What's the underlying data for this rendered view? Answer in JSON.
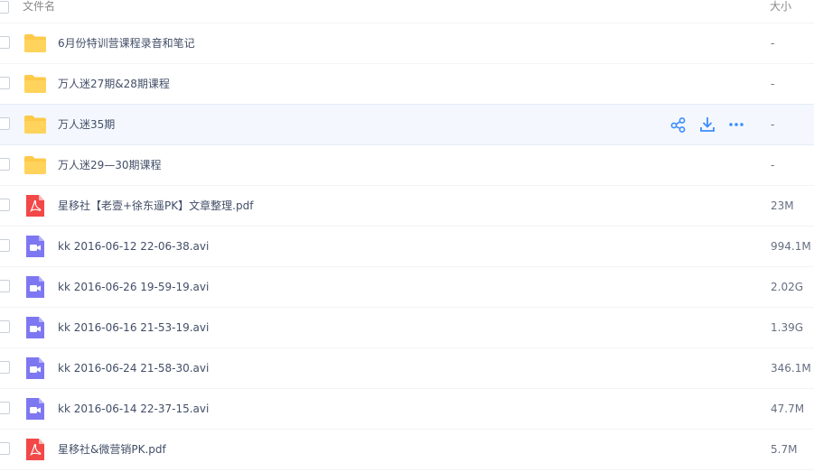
{
  "header": {
    "name_label": "文件名",
    "size_label": "大小"
  },
  "colors": {
    "folder": "#ffc94a",
    "pdf": "#f24848",
    "video": "#7d78f2",
    "action": "#3b8cff"
  },
  "rows": [
    {
      "name": "6月份特训营课程录音和笔记",
      "size": "-",
      "type": "folder",
      "icon": "folder-icon"
    },
    {
      "name": "万人迷27期&28期课程",
      "size": "-",
      "type": "folder",
      "icon": "folder-icon"
    },
    {
      "name": "万人迷35期",
      "size": "-",
      "type": "folder",
      "icon": "folder-icon",
      "hovered": true
    },
    {
      "name": "万人迷29—30期课程",
      "size": "-",
      "type": "folder",
      "icon": "folder-icon"
    },
    {
      "name": "星移社【老壹+徐东遥PK】文章整理.pdf",
      "size": "23M",
      "type": "pdf",
      "icon": "pdf-icon"
    },
    {
      "name": "kk 2016-06-12 22-06-38.avi",
      "size": "994.1M",
      "type": "video",
      "icon": "video-icon"
    },
    {
      "name": "kk 2016-06-26 19-59-19.avi",
      "size": "2.02G",
      "type": "video",
      "icon": "video-icon"
    },
    {
      "name": "kk 2016-06-16 21-53-19.avi",
      "size": "1.39G",
      "type": "video",
      "icon": "video-icon"
    },
    {
      "name": "kk 2016-06-24 21-58-30.avi",
      "size": "346.1M",
      "type": "video",
      "icon": "video-icon"
    },
    {
      "name": "kk 2016-06-14 22-37-15.avi",
      "size": "47.7M",
      "type": "video",
      "icon": "video-icon"
    },
    {
      "name": "星移社&微营销PK.pdf",
      "size": "5.7M",
      "type": "pdf",
      "icon": "pdf-icon"
    }
  ],
  "row_actions": {
    "share_icon": "share-icon",
    "download_icon": "download-icon",
    "more_icon": "more-icon"
  }
}
